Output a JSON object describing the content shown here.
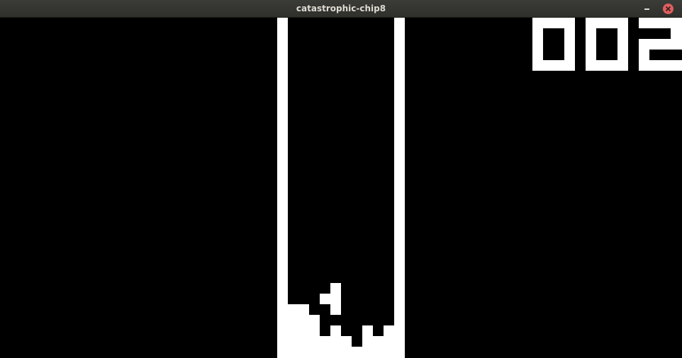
{
  "window": {
    "title": "catastrophic-chip8",
    "minimize_icon": "minimize-icon",
    "close_icon": "close-icon",
    "close_color": "#e05e5e"
  },
  "game": {
    "score": "002",
    "foreground": "#ffffff",
    "background": "#000000"
  }
}
